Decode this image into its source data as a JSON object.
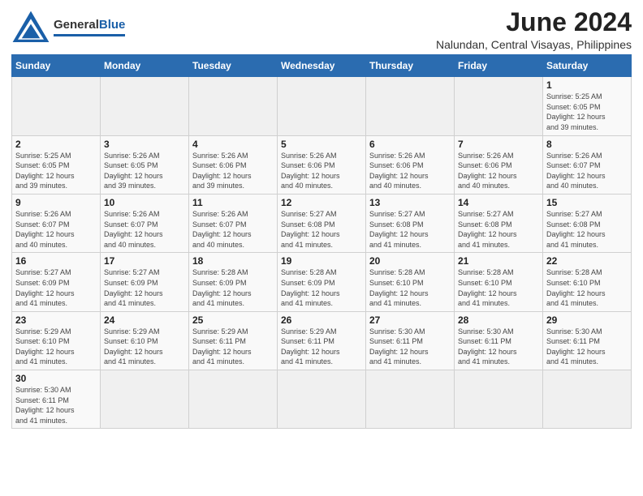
{
  "header": {
    "logo_general": "General",
    "logo_blue": "Blue",
    "month_title": "June 2024",
    "location": "Nalundan, Central Visayas, Philippines"
  },
  "days_of_week": [
    "Sunday",
    "Monday",
    "Tuesday",
    "Wednesday",
    "Thursday",
    "Friday",
    "Saturday"
  ],
  "weeks": [
    [
      {
        "day": "",
        "info": ""
      },
      {
        "day": "",
        "info": ""
      },
      {
        "day": "",
        "info": ""
      },
      {
        "day": "",
        "info": ""
      },
      {
        "day": "",
        "info": ""
      },
      {
        "day": "",
        "info": ""
      },
      {
        "day": "1",
        "info": "Sunrise: 5:25 AM\nSunset: 6:05 PM\nDaylight: 12 hours\nand 39 minutes."
      }
    ],
    [
      {
        "day": "2",
        "info": "Sunrise: 5:25 AM\nSunset: 6:05 PM\nDaylight: 12 hours\nand 39 minutes."
      },
      {
        "day": "3",
        "info": "Sunrise: 5:26 AM\nSunset: 6:05 PM\nDaylight: 12 hours\nand 39 minutes."
      },
      {
        "day": "4",
        "info": "Sunrise: 5:26 AM\nSunset: 6:06 PM\nDaylight: 12 hours\nand 39 minutes."
      },
      {
        "day": "5",
        "info": "Sunrise: 5:26 AM\nSunset: 6:06 PM\nDaylight: 12 hours\nand 40 minutes."
      },
      {
        "day": "6",
        "info": "Sunrise: 5:26 AM\nSunset: 6:06 PM\nDaylight: 12 hours\nand 40 minutes."
      },
      {
        "day": "7",
        "info": "Sunrise: 5:26 AM\nSunset: 6:06 PM\nDaylight: 12 hours\nand 40 minutes."
      },
      {
        "day": "8",
        "info": "Sunrise: 5:26 AM\nSunset: 6:07 PM\nDaylight: 12 hours\nand 40 minutes."
      }
    ],
    [
      {
        "day": "9",
        "info": "Sunrise: 5:26 AM\nSunset: 6:07 PM\nDaylight: 12 hours\nand 40 minutes."
      },
      {
        "day": "10",
        "info": "Sunrise: 5:26 AM\nSunset: 6:07 PM\nDaylight: 12 hours\nand 40 minutes."
      },
      {
        "day": "11",
        "info": "Sunrise: 5:26 AM\nSunset: 6:07 PM\nDaylight: 12 hours\nand 40 minutes."
      },
      {
        "day": "12",
        "info": "Sunrise: 5:27 AM\nSunset: 6:08 PM\nDaylight: 12 hours\nand 41 minutes."
      },
      {
        "day": "13",
        "info": "Sunrise: 5:27 AM\nSunset: 6:08 PM\nDaylight: 12 hours\nand 41 minutes."
      },
      {
        "day": "14",
        "info": "Sunrise: 5:27 AM\nSunset: 6:08 PM\nDaylight: 12 hours\nand 41 minutes."
      },
      {
        "day": "15",
        "info": "Sunrise: 5:27 AM\nSunset: 6:08 PM\nDaylight: 12 hours\nand 41 minutes."
      }
    ],
    [
      {
        "day": "16",
        "info": "Sunrise: 5:27 AM\nSunset: 6:09 PM\nDaylight: 12 hours\nand 41 minutes."
      },
      {
        "day": "17",
        "info": "Sunrise: 5:27 AM\nSunset: 6:09 PM\nDaylight: 12 hours\nand 41 minutes."
      },
      {
        "day": "18",
        "info": "Sunrise: 5:28 AM\nSunset: 6:09 PM\nDaylight: 12 hours\nand 41 minutes."
      },
      {
        "day": "19",
        "info": "Sunrise: 5:28 AM\nSunset: 6:09 PM\nDaylight: 12 hours\nand 41 minutes."
      },
      {
        "day": "20",
        "info": "Sunrise: 5:28 AM\nSunset: 6:10 PM\nDaylight: 12 hours\nand 41 minutes."
      },
      {
        "day": "21",
        "info": "Sunrise: 5:28 AM\nSunset: 6:10 PM\nDaylight: 12 hours\nand 41 minutes."
      },
      {
        "day": "22",
        "info": "Sunrise: 5:28 AM\nSunset: 6:10 PM\nDaylight: 12 hours\nand 41 minutes."
      }
    ],
    [
      {
        "day": "23",
        "info": "Sunrise: 5:29 AM\nSunset: 6:10 PM\nDaylight: 12 hours\nand 41 minutes."
      },
      {
        "day": "24",
        "info": "Sunrise: 5:29 AM\nSunset: 6:10 PM\nDaylight: 12 hours\nand 41 minutes."
      },
      {
        "day": "25",
        "info": "Sunrise: 5:29 AM\nSunset: 6:11 PM\nDaylight: 12 hours\nand 41 minutes."
      },
      {
        "day": "26",
        "info": "Sunrise: 5:29 AM\nSunset: 6:11 PM\nDaylight: 12 hours\nand 41 minutes."
      },
      {
        "day": "27",
        "info": "Sunrise: 5:30 AM\nSunset: 6:11 PM\nDaylight: 12 hours\nand 41 minutes."
      },
      {
        "day": "28",
        "info": "Sunrise: 5:30 AM\nSunset: 6:11 PM\nDaylight: 12 hours\nand 41 minutes."
      },
      {
        "day": "29",
        "info": "Sunrise: 5:30 AM\nSunset: 6:11 PM\nDaylight: 12 hours\nand 41 minutes."
      }
    ],
    [
      {
        "day": "30",
        "info": "Sunrise: 5:30 AM\nSunset: 6:11 PM\nDaylight: 12 hours\nand 41 minutes."
      },
      {
        "day": "",
        "info": ""
      },
      {
        "day": "",
        "info": ""
      },
      {
        "day": "",
        "info": ""
      },
      {
        "day": "",
        "info": ""
      },
      {
        "day": "",
        "info": ""
      },
      {
        "day": "",
        "info": ""
      }
    ]
  ]
}
